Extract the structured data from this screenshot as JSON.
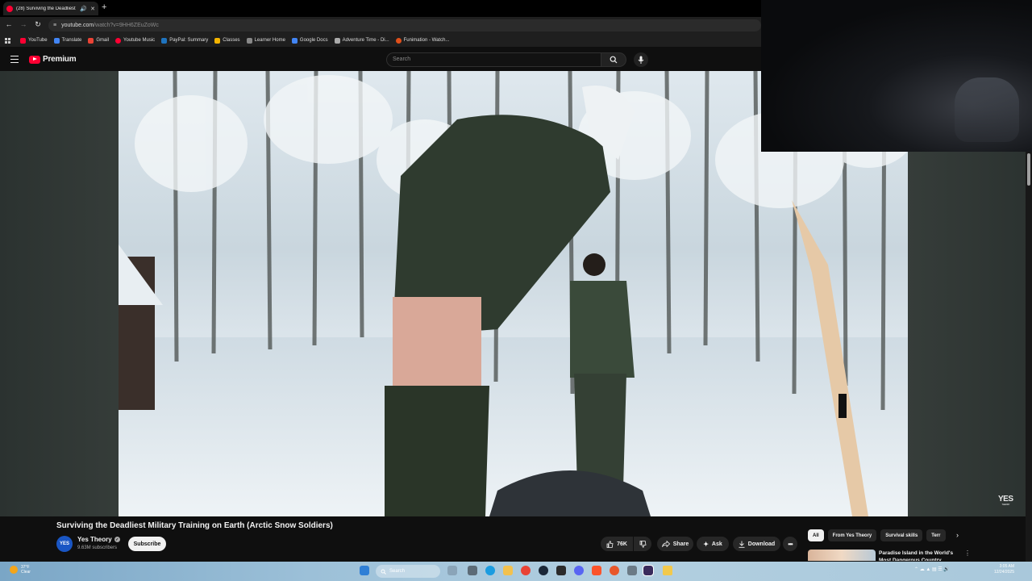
{
  "browser": {
    "tab_title": "(28) Surviving the Deadliest",
    "url_host": "youtube.com",
    "url_path": "/watch?v=9HH6ZEuZoWc",
    "bookmarks": [
      {
        "label": "YouTube",
        "color": "#ff0033"
      },
      {
        "label": "Translate",
        "color": "#4285f4"
      },
      {
        "label": "Gmail",
        "color": "#ea4335"
      },
      {
        "label": "Youtube Music",
        "color": "#ff0033"
      },
      {
        "label": "PayPal: Summary",
        "color": "#1f74bf"
      },
      {
        "label": "Classes",
        "color": "#f4b400"
      },
      {
        "label": "Learner Home",
        "color": "#888888"
      },
      {
        "label": "Google Docs",
        "color": "#4285f4"
      },
      {
        "label": "Adventure Time - Di...",
        "color": "#aaaaaa"
      },
      {
        "label": "Funimation - Watch...",
        "color": "#e0501b"
      }
    ]
  },
  "masthead": {
    "brand": "Premium",
    "search_placeholder": "Search"
  },
  "video": {
    "watermark": "YES",
    "watermark_sub": "THEORY"
  },
  "watch": {
    "title": "Surviving the Deadliest Military Training on Earth (Arctic Snow Soldiers)",
    "channel_avatar": "YES",
    "channel_name": "Yes Theory",
    "subscribers": "9.63M subscribers",
    "subscribe_label": "Subscribe",
    "like_count": "76K",
    "share_label": "Share",
    "ask_label": "Ask",
    "download_label": "Download"
  },
  "sidebar": {
    "chips": [
      "All",
      "From Yes Theory",
      "Survival skills",
      "Terr"
    ],
    "rec_title": "Paradise Island in the World's Most Dangerous Country"
  },
  "taskbar": {
    "weather_temp": "37°F",
    "weather_cond": "Clear",
    "search_label": "Search",
    "time": "3:05 AM",
    "date": "12/24/2025"
  },
  "colors": {
    "youtube_red": "#ff0033",
    "page_bg": "#0f0f0f",
    "chip_bg": "#272727"
  }
}
